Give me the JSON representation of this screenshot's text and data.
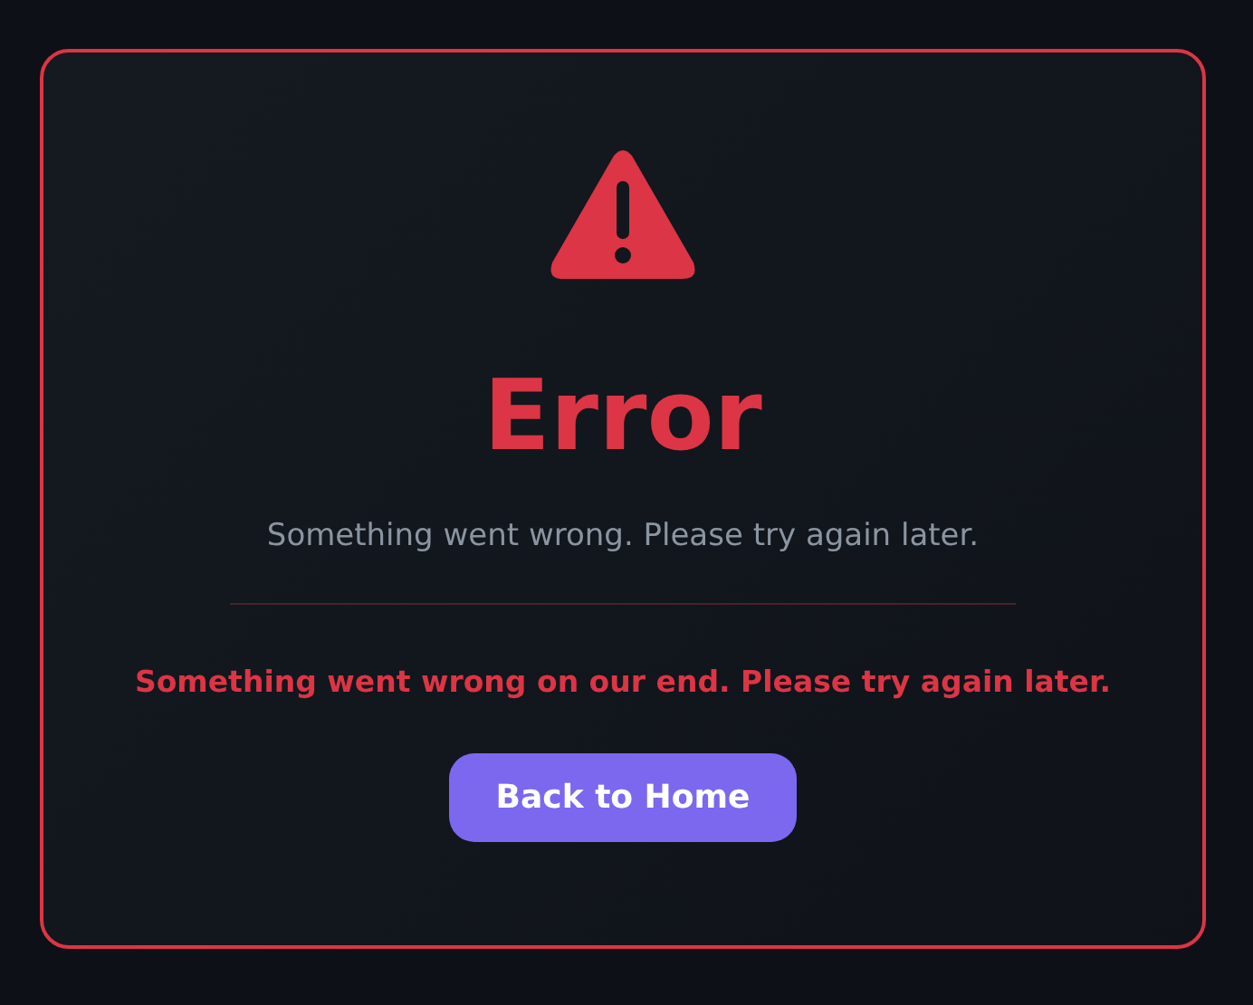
{
  "error": {
    "title": "Error",
    "subtitle": "Something went wrong. Please try again later.",
    "message": "Something went wrong on our end. Please try again later.",
    "button": "Back to Home"
  }
}
